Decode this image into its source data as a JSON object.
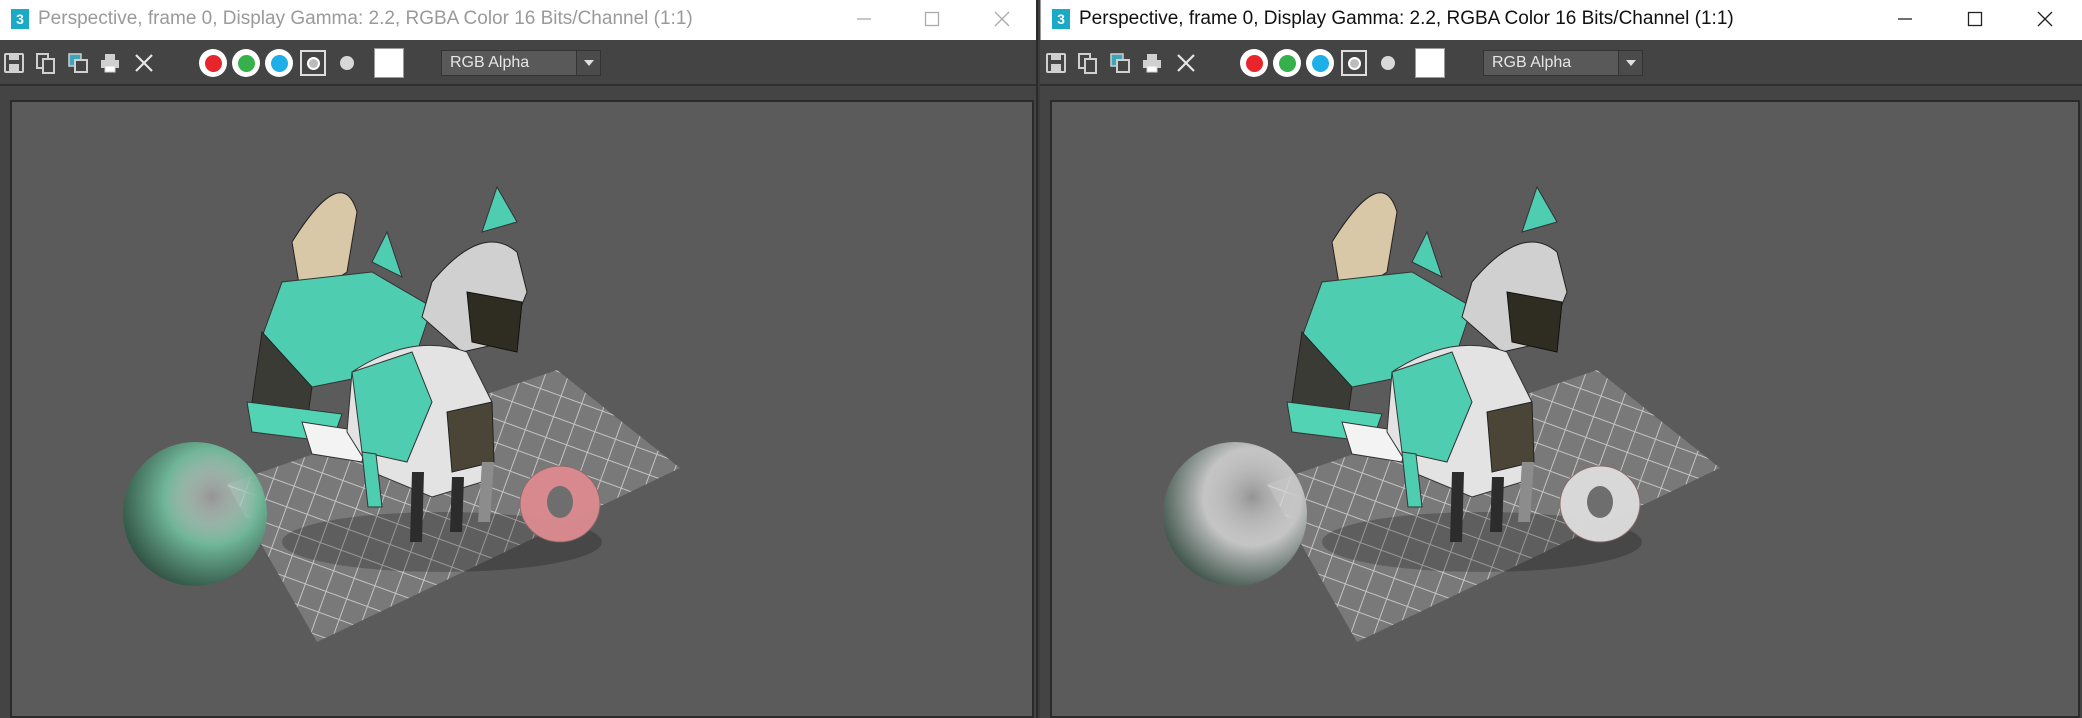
{
  "windows": [
    {
      "id": "left",
      "title": "Perspective, frame 0, Display Gamma: 2.2, RGBA Color 16 Bits/Channel (1:1)",
      "channel_dropdown": "RGB Alpha",
      "render": {
        "sphere_color": "#6fb597",
        "torus_color": "#d98a8e",
        "accent": "#46d1b0"
      }
    },
    {
      "id": "right",
      "title": "Perspective, frame 0, Display Gamma: 2.2, RGBA Color 16 Bits/Channel (1:1)",
      "channel_dropdown": "RGB Alpha",
      "render": {
        "sphere_color": "#c4c4c4",
        "torus_color": "#dadada",
        "accent": "#46d1b0"
      }
    }
  ],
  "toolbar_icons": [
    "save-icon",
    "copy-icon",
    "clone-window-icon",
    "print-icon",
    "clear-icon",
    "red-channel",
    "green-channel",
    "blue-channel",
    "monochrome-icon",
    "alpha-icon",
    "swatch"
  ],
  "colors": {
    "red_channel": "#e8252b",
    "green_channel": "#35b04a",
    "blue_channel": "#1eaee8",
    "app_icon": "#1aa9c6"
  }
}
